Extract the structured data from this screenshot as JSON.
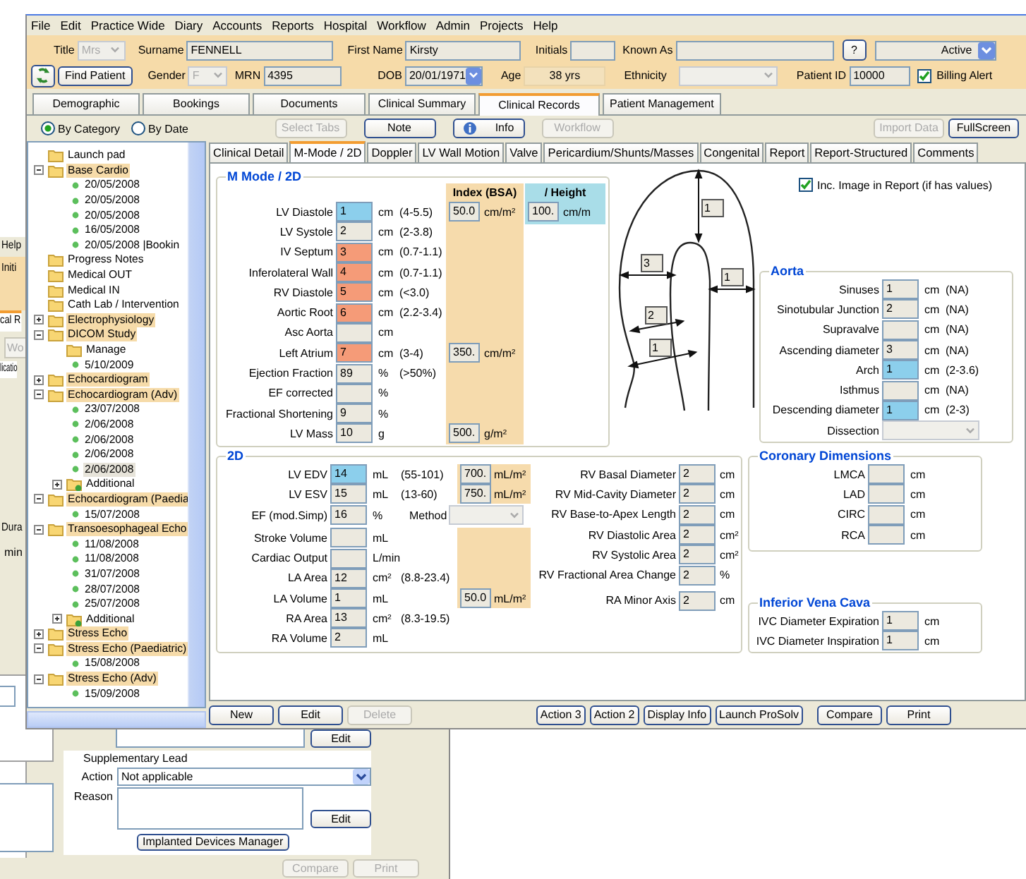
{
  "background_window": {
    "menu_item": "Help",
    "field_label": "Initi",
    "tab": "cal R",
    "button": "Wo",
    "section_label": "licatio",
    "duration_label": "Dura",
    "unit": "min",
    "edit_button": "Edit",
    "supplementary_lead": {
      "title": "Supplementary Lead",
      "action_label": "Action",
      "action_value": "Not applicable",
      "reason_label": "Reason",
      "edit_button": "Edit"
    },
    "devices_button": "Implanted Devices Manager",
    "footer_buttons": [
      {
        "label": "Compare",
        "disabled": true
      },
      {
        "label": "Print",
        "disabled": true
      }
    ]
  },
  "menu": [
    "File",
    "Edit",
    "Practice Wide",
    "Diary",
    "Accounts",
    "Reports",
    "Hospital",
    "Workflow",
    "Admin",
    "Projects",
    "Help"
  ],
  "patient": {
    "title": {
      "label": "Title",
      "value": "Mrs",
      "disabled": true
    },
    "surname": {
      "label": "Surname",
      "value": "FENNELL"
    },
    "first_name": {
      "label": "First Name",
      "value": "Kirsty"
    },
    "initials": {
      "label": "Initials"
    },
    "known_as": {
      "label": "Known As"
    },
    "help_button": "?",
    "status": {
      "value": "Active"
    },
    "find_button": "Find Patient",
    "gender": {
      "label": "Gender",
      "value": "F",
      "disabled": true
    },
    "mrn": {
      "label": "MRN",
      "value": "4395"
    },
    "dob": {
      "label": "DOB",
      "value": "20/01/1971"
    },
    "age": {
      "label": "Age",
      "value": "38 yrs"
    },
    "ethnicity": {
      "label": "Ethnicity",
      "disabled": true
    },
    "patient_id": {
      "label": "Patient ID",
      "value": "10000"
    },
    "billing_alert": {
      "label": "Billing Alert",
      "checked": true
    }
  },
  "tabs": [
    {
      "label": "Demographic",
      "selected": false
    },
    {
      "label": "Bookings",
      "selected": false
    },
    {
      "label": "Documents",
      "selected": false
    },
    {
      "label": "Clinical Summary",
      "selected": false
    },
    {
      "label": "Clinical Records",
      "selected": true
    },
    {
      "label": "Patient Management",
      "selected": false
    }
  ],
  "view_options": [
    {
      "label": "By Category",
      "selected": true
    },
    {
      "label": "By Date",
      "selected": false
    }
  ],
  "toolbar_buttons": [
    {
      "label": "Select Tabs",
      "disabled": true,
      "kind": "plain"
    },
    {
      "label": "Note",
      "disabled": false,
      "kind": "plain"
    },
    {
      "label": "Info",
      "disabled": false,
      "kind": "info"
    },
    {
      "label": "Workflow",
      "disabled": true,
      "kind": "plain"
    }
  ],
  "toolbar_right_buttons": [
    {
      "label": "Import Data",
      "disabled": true
    },
    {
      "label": "FullScreen",
      "disabled": false
    }
  ],
  "tree": [
    {
      "label": "Launch pad",
      "kind": "folder",
      "highlighted": false,
      "selected": false
    },
    {
      "label": "Base Cardio",
      "kind": "folder",
      "highlighted": true,
      "expanded": true,
      "selected": false,
      "children": [
        {
          "label": "20/05/2008",
          "kind": "record",
          "selected": false
        },
        {
          "label": "20/05/2008",
          "kind": "record",
          "selected": false
        },
        {
          "label": "20/05/2008",
          "kind": "record",
          "selected": false
        },
        {
          "label": "16/05/2008",
          "kind": "record",
          "selected": false
        },
        {
          "label": "20/05/2008 |Bookin",
          "kind": "record",
          "selected": false
        }
      ]
    },
    {
      "label": "Progress Notes",
      "kind": "folder",
      "highlighted": false,
      "selected": false
    },
    {
      "label": "Medical OUT",
      "kind": "folder",
      "highlighted": false,
      "selected": false
    },
    {
      "label": "Medical IN",
      "kind": "folder",
      "highlighted": false,
      "selected": false
    },
    {
      "label": "Cath Lab / Intervention",
      "kind": "folder",
      "highlighted": false,
      "selected": false
    },
    {
      "label": "Electrophysiology",
      "kind": "folder",
      "highlighted": true,
      "expanded": false,
      "selected": false
    },
    {
      "label": "DICOM Study",
      "kind": "folder",
      "highlighted": true,
      "expanded": true,
      "selected": false,
      "children": [
        {
          "label": "Manage",
          "kind": "folder",
          "highlighted": false,
          "selected": false
        },
        {
          "label": "5/10/2009",
          "kind": "record",
          "selected": false
        }
      ]
    },
    {
      "label": "Echocardiogram",
      "kind": "folder",
      "highlighted": true,
      "expanded": false,
      "selected": false
    },
    {
      "label": "Echocardiogram (Adv)",
      "kind": "folder",
      "highlighted": true,
      "expanded": true,
      "selected": false,
      "children": [
        {
          "label": "23/07/2008",
          "kind": "record",
          "selected": false
        },
        {
          "label": "2/06/2008",
          "kind": "record",
          "selected": false
        },
        {
          "label": "2/06/2008",
          "kind": "record",
          "selected": false
        },
        {
          "label": "2/06/2008",
          "kind": "record",
          "selected": false
        },
        {
          "label": "2/06/2008",
          "kind": "record",
          "selected": true
        },
        {
          "label": "Additional",
          "kind": "add-folder",
          "highlighted": false,
          "expanded": false,
          "selected": false
        }
      ]
    },
    {
      "label": "Echocardiogram (Paedia",
      "kind": "folder",
      "highlighted": true,
      "expanded": true,
      "selected": false,
      "children": [
        {
          "label": "15/07/2008",
          "kind": "record",
          "selected": false
        }
      ]
    },
    {
      "label": "Transoesophageal Echo",
      "kind": "folder",
      "highlighted": true,
      "expanded": true,
      "selected": false,
      "children": [
        {
          "label": "11/08/2008",
          "kind": "record",
          "selected": false
        },
        {
          "label": "11/08/2008",
          "kind": "record",
          "selected": false
        },
        {
          "label": "31/07/2008",
          "kind": "record",
          "selected": false
        },
        {
          "label": "28/07/2008",
          "kind": "record",
          "selected": false
        },
        {
          "label": "25/07/2008",
          "kind": "record",
          "selected": false
        },
        {
          "label": "Additional",
          "kind": "add-folder",
          "highlighted": false,
          "expanded": false,
          "selected": false
        }
      ]
    },
    {
      "label": "Stress Echo",
      "kind": "folder",
      "highlighted": true,
      "expanded": false,
      "selected": false
    },
    {
      "label": "Stress Echo (Paediatric)",
      "kind": "folder",
      "highlighted": true,
      "expanded": true,
      "selected": false,
      "children": [
        {
          "label": "15/08/2008",
          "kind": "record",
          "selected": false
        }
      ]
    },
    {
      "label": "Stress Echo (Adv)",
      "kind": "folder",
      "highlighted": true,
      "expanded": true,
      "selected": false,
      "children": [
        {
          "label": "15/09/2008",
          "kind": "record",
          "selected": false
        }
      ]
    }
  ],
  "inner_tabs": [
    {
      "label": "Clinical Detail",
      "selected": false
    },
    {
      "label": "M-Mode / 2D",
      "selected": true
    },
    {
      "label": "Doppler",
      "selected": false
    },
    {
      "label": "LV Wall Motion",
      "selected": false
    },
    {
      "label": "Valve",
      "selected": false
    },
    {
      "label": "Pericardium/Shunts/Masses",
      "selected": false
    },
    {
      "label": "Congenital",
      "selected": false
    },
    {
      "label": "Report",
      "selected": false
    },
    {
      "label": "Report-Structured",
      "selected": false
    },
    {
      "label": "Comments",
      "selected": false
    }
  ],
  "mmode": {
    "title": "M Mode / 2D",
    "index_header": "Index (BSA)",
    "height_header": "/ Height",
    "height": {
      "value": "100.",
      "unit": "cm/m"
    },
    "rows": [
      {
        "label": "LV Diastole",
        "value": "1",
        "low": true,
        "high": false,
        "unit": "cm",
        "range": "(4-5.5)",
        "index": {
          "value": "50.0",
          "unit": "cm/m²"
        }
      },
      {
        "label": "LV Systole",
        "value": "2",
        "low": false,
        "high": false,
        "unit": "cm",
        "range": "(2-3.8)"
      },
      {
        "label": "IV Septum",
        "value": "3",
        "low": false,
        "high": true,
        "unit": "cm",
        "range": "(0.7-1.1)"
      },
      {
        "label": "Inferolateral Wall",
        "value": "4",
        "low": false,
        "high": true,
        "unit": "cm",
        "range": "(0.7-1.1)"
      },
      {
        "label": "RV Diastole",
        "value": "5",
        "low": false,
        "high": true,
        "unit": "cm",
        "range": "(<3.0)"
      },
      {
        "label": "Aortic Root",
        "value": "6",
        "low": false,
        "high": true,
        "unit": "cm",
        "range": "(2.2-3.4)"
      },
      {
        "label": "Asc Aorta",
        "low": false,
        "high": false,
        "unit": "cm"
      },
      {
        "label": "Left Atrium",
        "value": "7",
        "low": false,
        "high": true,
        "unit": "cm",
        "range": "(3-4)",
        "index": {
          "value": "350.",
          "unit": "cm/m²"
        }
      },
      {
        "label": "Ejection Fraction",
        "value": "89",
        "low": false,
        "high": false,
        "unit": "%",
        "range": "(>50%)"
      },
      {
        "label": "EF corrected",
        "low": false,
        "high": false,
        "unit": "%"
      },
      {
        "label": "Fractional Shortening",
        "value": "9",
        "low": false,
        "high": false,
        "unit": "%"
      },
      {
        "label": "LV Mass",
        "value": "10",
        "low": false,
        "high": false,
        "unit": "g",
        "index": {
          "value": "500.",
          "unit": "g/m²"
        }
      }
    ]
  },
  "diagram": {
    "measurements": [
      "1",
      "3",
      "1",
      "2",
      "1"
    ]
  },
  "include_image": {
    "label": "Inc. Image in Report (if has values)",
    "checked": true
  },
  "aorta": {
    "title": "Aorta",
    "rows": [
      {
        "label": "Sinuses",
        "value": "1",
        "low": false,
        "high": false,
        "unit": "cm",
        "range": "(NA)"
      },
      {
        "label": "Sinotubular Junction",
        "value": "2",
        "low": false,
        "high": false,
        "unit": "cm",
        "range": "(NA)"
      },
      {
        "label": "Supravalve",
        "low": false,
        "high": false,
        "unit": "cm",
        "range": "(NA)"
      },
      {
        "label": "Ascending diameter",
        "value": "3",
        "low": false,
        "high": false,
        "unit": "cm",
        "range": "(NA)"
      },
      {
        "label": "Arch",
        "value": "1",
        "low": true,
        "high": false,
        "unit": "cm",
        "range": "(2-3.6)"
      },
      {
        "label": "Isthmus",
        "low": false,
        "high": false,
        "unit": "cm",
        "range": "(NA)"
      },
      {
        "label": "Descending diameter",
        "value": "1",
        "low": true,
        "high": false,
        "unit": "cm",
        "range": "(2-3)"
      }
    ],
    "dissection_label": "Dissection"
  },
  "two_d": {
    "title": "2D",
    "method_label": "Method",
    "rows": [
      {
        "label": "LV EDV",
        "value": "14",
        "low": true,
        "high": false,
        "unit": "mL",
        "range": "(55-101)",
        "index": {
          "value": "700.",
          "unit": "mL/m²"
        }
      },
      {
        "label": "LV ESV",
        "value": "15",
        "low": false,
        "high": false,
        "unit": "mL",
        "range": "(13-60)",
        "index": {
          "value": "750.",
          "unit": "mL/m²"
        }
      },
      {
        "label": "EF (mod.Simp)",
        "value": "16",
        "low": false,
        "high": false,
        "unit": "%"
      },
      {
        "label": "Stroke Volume",
        "low": false,
        "high": false,
        "unit": "mL"
      },
      {
        "label": "Cardiac Output",
        "low": false,
        "high": false,
        "unit": "L/min"
      },
      {
        "label": "LA Area",
        "value": "12",
        "low": false,
        "high": false,
        "unit": "cm²",
        "range": "(8.8-23.4)"
      },
      {
        "label": "LA Volume",
        "value": "1",
        "low": false,
        "high": false,
        "unit": "mL",
        "index": {
          "value": "50.0",
          "unit": "mL/m²"
        }
      },
      {
        "label": "RA Area",
        "value": "13",
        "low": false,
        "high": false,
        "unit": "cm²",
        "range": "(8.3-19.5)"
      },
      {
        "label": "RA Volume",
        "value": "2",
        "low": false,
        "high": false,
        "unit": "mL"
      }
    ],
    "rv_rows": [
      {
        "label": "RV Basal Diameter",
        "value": "2",
        "unit": "cm"
      },
      {
        "label": "RV Mid-Cavity Diameter",
        "value": "2",
        "unit": "cm"
      },
      {
        "label": "RV Base-to-Apex Length",
        "value": "2",
        "unit": "cm"
      },
      {
        "label": "RV Diastolic Area",
        "value": "2",
        "unit": "cm²"
      },
      {
        "label": "RV Systolic Area",
        "value": "2",
        "unit": "cm²"
      },
      {
        "label": "RV Fractional Area Change",
        "value": "2",
        "unit": "%"
      },
      {
        "label": "RA Minor Axis",
        "value": "2",
        "unit": "cm"
      }
    ]
  },
  "coronary": {
    "title": "Coronary Dimensions",
    "rows": [
      {
        "label": "LMCA",
        "unit": "cm"
      },
      {
        "label": "LAD",
        "unit": "cm"
      },
      {
        "label": "CIRC",
        "unit": "cm"
      },
      {
        "label": "RCA",
        "unit": "cm"
      }
    ]
  },
  "ivc": {
    "title": "Inferior Vena Cava",
    "rows": [
      {
        "label": "IVC Diameter Expiration",
        "value": "1",
        "unit": "cm"
      },
      {
        "label": "IVC Diameter Inspiration",
        "value": "1",
        "unit": "cm"
      }
    ]
  },
  "record_buttons": [
    {
      "label": "New",
      "disabled": false
    },
    {
      "label": "Edit",
      "disabled": false
    },
    {
      "label": "Delete",
      "disabled": true
    }
  ],
  "action_buttons": [
    {
      "label": "Action 3"
    },
    {
      "label": "Action 2"
    },
    {
      "label": "Display Info"
    },
    {
      "label": "Launch ProSolv"
    }
  ],
  "output_buttons": [
    {
      "label": "Compare"
    },
    {
      "label": "Print"
    }
  ]
}
